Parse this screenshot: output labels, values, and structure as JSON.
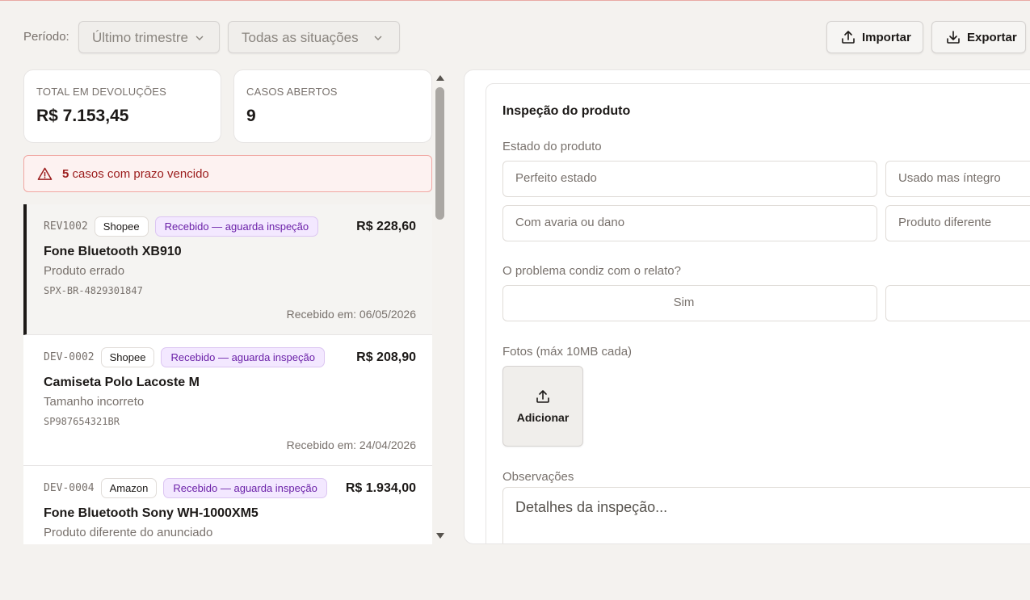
{
  "toolbar": {
    "periodo_label": "Período:",
    "periodo_value": "Último trimestre",
    "situacao_value": "Todas as situações",
    "import_label": "Importar",
    "export_label": "Exportar"
  },
  "kpis": {
    "total_label": "TOTAL EM DEVOLUÇÕES",
    "total_value": "R$ 7.153,45",
    "abertos_label": "CASOS ABERTOS",
    "abertos_value": "9"
  },
  "alert": {
    "count": "5",
    "text": "casos com prazo vencido"
  },
  "cases": [
    {
      "id": "REV1002",
      "marketplace": "Shopee",
      "status": "Recebido — aguarda inspeção",
      "amount": "R$ 228,60",
      "title": "Fone Bluetooth XB910",
      "reason": "Produto errado",
      "tracking": "SPX-BR-4829301847",
      "date": "Recebido em: 06/05/2026"
    },
    {
      "id": "DEV-0002",
      "marketplace": "Shopee",
      "status": "Recebido — aguarda inspeção",
      "amount": "R$ 208,90",
      "title": "Camiseta Polo Lacoste M",
      "reason": "Tamanho incorreto",
      "tracking": "SP987654321BR",
      "date": "Recebido em: 24/04/2026"
    },
    {
      "id": "DEV-0004",
      "marketplace": "Amazon",
      "status": "Recebido — aguarda inspeção",
      "amount": "R$ 1.934,00",
      "title": "Fone Bluetooth Sony WH-1000XM5",
      "reason": "Produto diferente do anunciado"
    }
  ],
  "inspection": {
    "title": "Inspeção do produto",
    "estado_label": "Estado do produto",
    "estado_options": [
      "Perfeito estado",
      "Usado mas íntegro",
      "Com avaria ou dano",
      "Produto diferente"
    ],
    "condiz_label": "O problema condiz com o relato?",
    "condiz_options": [
      "Sim",
      ""
    ],
    "fotos_label": "Fotos (máx 10MB cada)",
    "add_label": "Adicionar",
    "obs_label": "Observações",
    "obs_placeholder": "Detalhes da inspeção..."
  }
}
